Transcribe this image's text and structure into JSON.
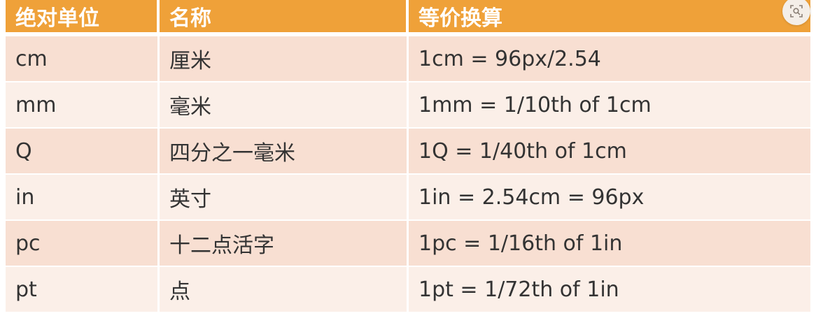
{
  "table": {
    "headers": [
      "绝对单位",
      "名称",
      "等价换算"
    ],
    "rows": [
      [
        "cm",
        "厘米",
        "1cm = 96px/2.54"
      ],
      [
        "mm",
        "毫米",
        "1mm = 1/10th of 1cm"
      ],
      [
        "Q",
        "四分之一毫米",
        "1Q = 1/40th of 1cm"
      ],
      [
        "in",
        "英寸",
        "1in = 2.54cm = 96px"
      ],
      [
        "pc",
        "十二点活字",
        "1pc = 1/16th of 1in"
      ],
      [
        "pt",
        "点",
        "1pt = 1/72th of 1in"
      ]
    ]
  },
  "icons": {
    "corner": "image-search-icon"
  },
  "colors": {
    "header_bg": "#efa139",
    "row_odd": "#f8dfd2",
    "row_even": "#fbefe8"
  }
}
